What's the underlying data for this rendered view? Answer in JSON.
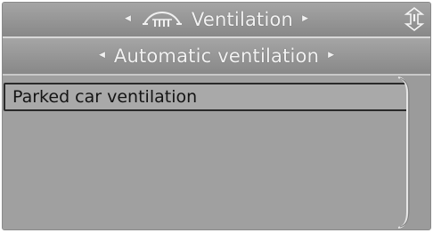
{
  "header": {
    "title": "Ventilation",
    "icon": "ventilation-icon"
  },
  "submenu": {
    "title": "Automatic ventilation"
  },
  "list": {
    "items": [
      {
        "label": "Parked car ventilation",
        "selected": true
      }
    ]
  },
  "colors": {
    "panel": "#a2a2a2",
    "header": "#8c8c8c",
    "text_light": "#f2f2f2",
    "text_dark": "#141414"
  }
}
